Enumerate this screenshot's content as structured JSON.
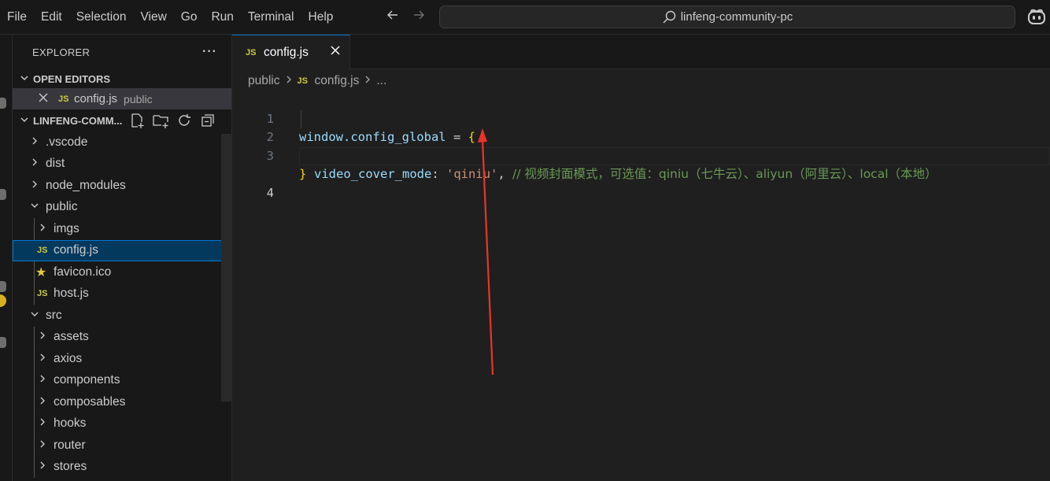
{
  "menu": [
    "File",
    "Edit",
    "Selection",
    "View",
    "Go",
    "Run",
    "Terminal",
    "Help"
  ],
  "search": {
    "text": "linfeng-community-pc"
  },
  "icons": {
    "back": "arrow-left-icon",
    "forward": "arrow-right-icon",
    "search": "search-icon",
    "copilot": "copilot-icon"
  },
  "sidebar": {
    "title": "EXPLORER",
    "more": "···",
    "open_editors_title": "OPEN EDITORS",
    "open_editor": {
      "badge": "JS",
      "name": "config.js",
      "folder": "public"
    },
    "project_title": "LINFENG-COMM...",
    "tree": [
      {
        "label": ".vscode",
        "kind": "folder"
      },
      {
        "label": "dist",
        "kind": "folder"
      },
      {
        "label": "node_modules",
        "kind": "folder"
      },
      {
        "label": "public",
        "kind": "folder-open"
      },
      {
        "label": "imgs",
        "kind": "folder"
      },
      {
        "label": "config.js",
        "kind": "js",
        "badge": "JS"
      },
      {
        "label": "favicon.ico",
        "kind": "star"
      },
      {
        "label": "host.js",
        "kind": "js",
        "badge": "JS"
      },
      {
        "label": "src",
        "kind": "folder-open"
      },
      {
        "label": "assets",
        "kind": "folder"
      },
      {
        "label": "axios",
        "kind": "folder"
      },
      {
        "label": "components",
        "kind": "folder"
      },
      {
        "label": "composables",
        "kind": "folder"
      },
      {
        "label": "hooks",
        "kind": "folder"
      },
      {
        "label": "router",
        "kind": "folder"
      },
      {
        "label": "stores",
        "kind": "folder"
      }
    ]
  },
  "editor": {
    "tab": {
      "badge": "JS",
      "label": "config.js",
      "close": "✕"
    },
    "breadcrumb": {
      "folder": "public",
      "badge": "JS",
      "file": "config.js",
      "more": "..."
    },
    "lines": [
      {
        "num": "1",
        "p1": "window.config_global",
        "p2": " = ",
        "brace": "{"
      },
      {
        "num": "2",
        "key": "video_cover_mode",
        "colon": ": ",
        "str": "'qiniu'",
        "comma": ", ",
        "comment": "// 视频封面模式，可选值：qiniu（七牛云）、aliyun（阿里云）、local（本地）"
      },
      {
        "num": "3",
        "brace": "}"
      },
      {
        "num": "4"
      }
    ]
  },
  "colors": {
    "accent": "#0078d4",
    "arrow": "#e8352b",
    "string": "#ce9178",
    "comment": "#6a9955",
    "identifier": "#9cdcfe",
    "brace": "#ffd700",
    "js_badge": "#cbcb41"
  }
}
